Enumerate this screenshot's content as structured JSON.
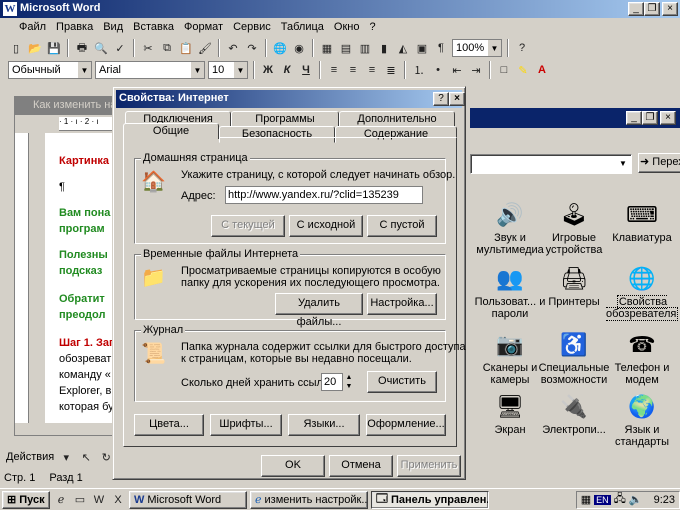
{
  "word": {
    "title": "Microsoft Word",
    "menu": [
      "Файл",
      "Правка",
      "Вид",
      "Вставка",
      "Формат",
      "Сервис",
      "Таблица",
      "Окно",
      "?"
    ],
    "zoom": "100%",
    "style": "Обычный",
    "font": "Arial",
    "size": "10",
    "bold": "Ж",
    "italic": "К",
    "underline": "Ч"
  },
  "doc": {
    "title": "Как изменить на",
    "lines": [
      {
        "text": "Картинка",
        "kind": "red"
      },
      {
        "text": "¶",
        "kind": "plain"
      },
      {
        "text": "Вам пона",
        "kind": "green"
      },
      {
        "text": "програм",
        "kind": "green"
      },
      {
        "text": "Полезны",
        "kind": "green"
      },
      {
        "text": "подсказ",
        "kind": "green"
      },
      {
        "text": "Обратит",
        "kind": "green"
      },
      {
        "text": "преодол",
        "kind": "green"
      },
      {
        "text": "Шаг 1. Зап",
        "kind": "red"
      },
      {
        "text": "обозреват",
        "kind": "plain"
      },
      {
        "text": "команду «",
        "kind": "plain"
      },
      {
        "text": "Explorer, в",
        "kind": "plain"
      },
      {
        "text": "которая бу",
        "kind": "plain"
      }
    ]
  },
  "dialog": {
    "title": "Свойства: Интернет",
    "help": "?",
    "close": "×",
    "tabs_back": [
      "Подключения",
      "Программы",
      "Дополнительно"
    ],
    "tabs_front": [
      "Общие",
      "Безопасность",
      "Содержание"
    ],
    "home": {
      "label": "Домашняя страница",
      "desc": "Укажите страницу, с которой следует начинать обзор.",
      "addr_label": "Адрес:",
      "addr_value": "http://www.yandex.ru/?clid=135239",
      "btn_current": "С текущей",
      "btn_default": "С исходной",
      "btn_blank": "С пустой"
    },
    "temp": {
      "label": "Временные файлы Интернета",
      "desc1": "Просматриваемые страницы копируются в особую",
      "desc2": "папку для ускорения их последующего просмотра.",
      "btn_delete": "Удалить файлы...",
      "btn_settings": "Настройка..."
    },
    "history": {
      "label": "Журнал",
      "desc1": "Папка журнала содержит ссылки для быстрого доступа",
      "desc2": "к страницам, которые вы недавно посещали.",
      "days_label": "Сколько дней хранить ссылки:",
      "days_value": "20",
      "btn_clear": "Очистить"
    },
    "btn_colors": "Цвета...",
    "btn_fonts": "Шрифты...",
    "btn_langs": "Языки...",
    "btn_access": "Оформление...",
    "ok": "OK",
    "cancel": "Отмена",
    "apply": "Применить"
  },
  "cp": {
    "go": "Переход",
    "items": [
      {
        "label": "Звук и мультимедиа",
        "icon": "speaker-icon"
      },
      {
        "label": "Игровые устройства",
        "icon": "joystick-icon"
      },
      {
        "label": "Клавиатура",
        "icon": "keyboard-icon"
      },
      {
        "label": "Пользоват... и пароли",
        "icon": "users-icon"
      },
      {
        "label": "Принтеры",
        "icon": "printer-icon"
      },
      {
        "label": "Свойства обозревателя",
        "icon": "internet-options-icon"
      },
      {
        "label": "Сканеры и камеры",
        "icon": "scanner-icon"
      },
      {
        "label": "Специальные возможности",
        "icon": "accessibility-icon"
      },
      {
        "label": "Телефон и модем",
        "icon": "phone-icon"
      },
      {
        "label": "Экран",
        "icon": "display-icon"
      },
      {
        "label": "Электропи...",
        "icon": "power-icon"
      },
      {
        "label": "Язык и стандарты",
        "icon": "globe-icon"
      }
    ]
  },
  "drawbar": {
    "actions": "Действия"
  },
  "status": {
    "page": "Стр. 1",
    "section": "Разд 1"
  },
  "taskbar": {
    "start": "Пуск",
    "tasks": [
      "Microsoft Word",
      "изменить настройк...",
      "Панель управлен..."
    ],
    "lang": "EN",
    "time": "9:23"
  }
}
